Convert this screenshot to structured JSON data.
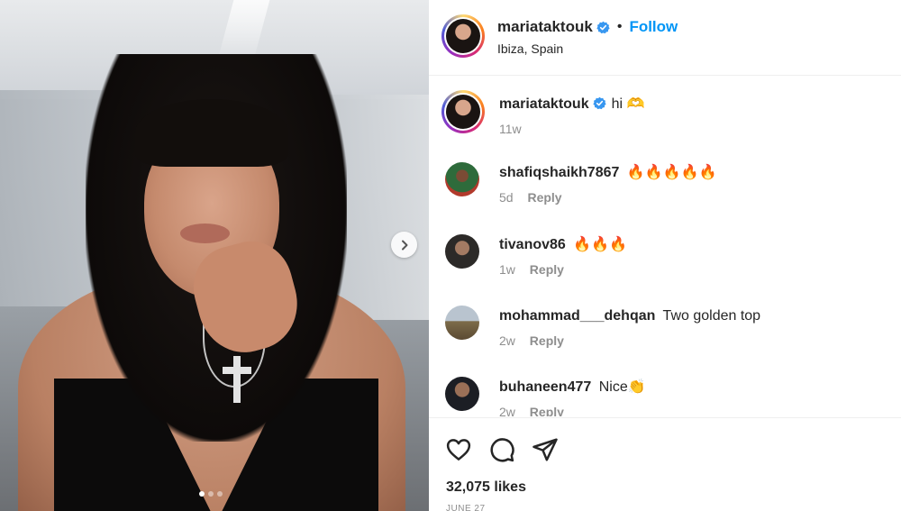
{
  "post": {
    "carousel_dots": 3,
    "active_dot": 0,
    "next_icon": "chevron-right-icon"
  },
  "header": {
    "username": "mariataktouk",
    "separator": "•",
    "follow_label": "Follow",
    "location": "Ibiza, Spain",
    "verified_icon": "verified-badge-icon"
  },
  "caption": {
    "username": "mariataktouk",
    "text": "hi 🫶",
    "time": "11w"
  },
  "comments": [
    {
      "username": "shafiqshaikh7867",
      "text": "🔥🔥🔥🔥🔥",
      "time": "5d",
      "reply_label": "Reply"
    },
    {
      "username": "tivanov86",
      "text": "🔥🔥🔥",
      "time": "1w",
      "reply_label": "Reply"
    },
    {
      "username": "mohammad___dehqan",
      "text": "Two golden top",
      "time": "2w",
      "reply_label": "Reply"
    },
    {
      "username": "buhaneen477",
      "text": "Nice👏",
      "time": "2w",
      "reply_label": "Reply"
    }
  ],
  "actions": {
    "like_icon": "heart-icon",
    "comment_icon": "comment-icon",
    "share_icon": "share-icon",
    "likes_text": "32,075 likes",
    "date": "JUNE 27"
  },
  "colors": {
    "accent": "#0095f6",
    "text": "#262626",
    "muted": "#8e8e8e",
    "verified": "#3897f0"
  }
}
